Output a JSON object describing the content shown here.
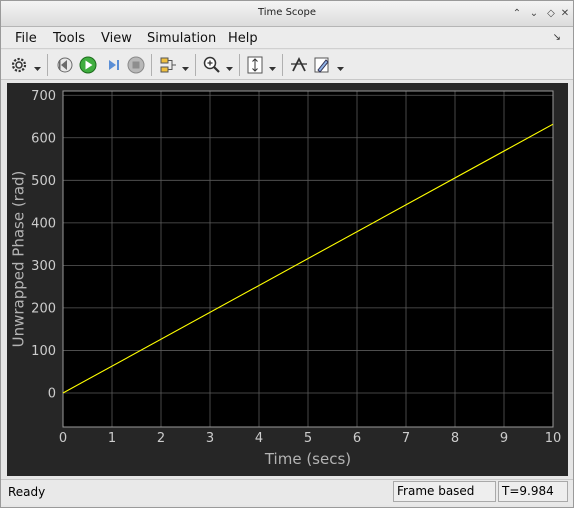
{
  "window": {
    "title": "Time Scope"
  },
  "menu": {
    "file": "File",
    "tools": "Tools",
    "view": "View",
    "simulation": "Simulation",
    "help": "Help"
  },
  "toolbar": {
    "icons": [
      "gear-icon",
      "step-back-icon",
      "run-icon",
      "step-forward-icon",
      "stop-icon",
      "signal-select-icon",
      "zoom-in-icon",
      "scale-axes-icon",
      "cursor-measure-icon",
      "style-edit-icon"
    ]
  },
  "status": {
    "ready": "Ready",
    "mode": "Frame based",
    "time": "T=9.984"
  },
  "colors": {
    "axes_background": "#000000",
    "figure_background": "#262626",
    "line": "#ffff00",
    "grid": "#5a5a5a",
    "tick_text": "#cccccc"
  },
  "chart_data": {
    "type": "line",
    "title": "",
    "xlabel": "Time (secs)",
    "ylabel": "Unwrapped Phase (rad)",
    "xlim": [
      0,
      10
    ],
    "ylim": [
      -80,
      710
    ],
    "xticks": [
      0,
      1,
      2,
      3,
      4,
      5,
      6,
      7,
      8,
      9,
      10
    ],
    "yticks": [
      0,
      100,
      200,
      300,
      400,
      500,
      600,
      700
    ],
    "grid": true,
    "series": [
      {
        "x": [
          0,
          10
        ],
        "y": [
          0,
          632
        ]
      }
    ]
  }
}
